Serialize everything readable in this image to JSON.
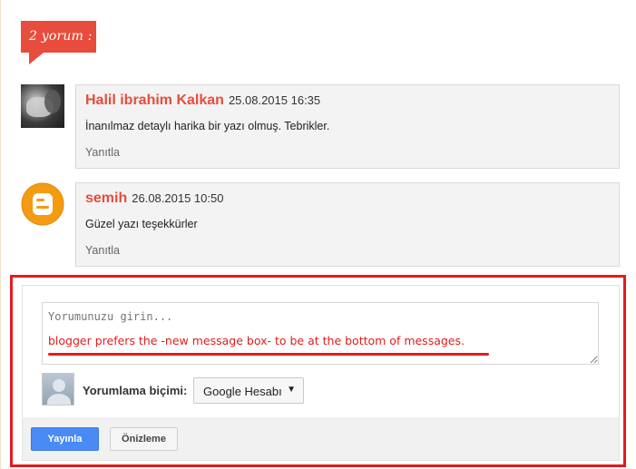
{
  "comments_header": {
    "count_label": "2 yorum :"
  },
  "comments": [
    {
      "author": "Halil ibrahim Kalkan",
      "date": "25.08.2015 16:35",
      "text": "İnanılmaz detaylı harika bir yazı olmuş. Tebrikler.",
      "reply_label": "Yanıtla"
    },
    {
      "author": "semih",
      "date": "26.08.2015 10:50",
      "text": "Güzel yazı teşekkürler",
      "reply_label": "Yanıtla"
    }
  ],
  "comment_form": {
    "placeholder": "Yorumunuzu girin...",
    "format_label": "Yorumlama biçimi:",
    "format_selected": "Google Hesabı",
    "publish_label": "Yayınla",
    "preview_label": "Önizleme"
  },
  "annotation": {
    "note": "blogger prefers the -new message box- to be at the bottom of messages.",
    "color": "#e31b1b"
  },
  "colors": {
    "accent": "#e74c3c",
    "publish_button": "#4a8af4",
    "blogger_orange": "#f39c12"
  }
}
